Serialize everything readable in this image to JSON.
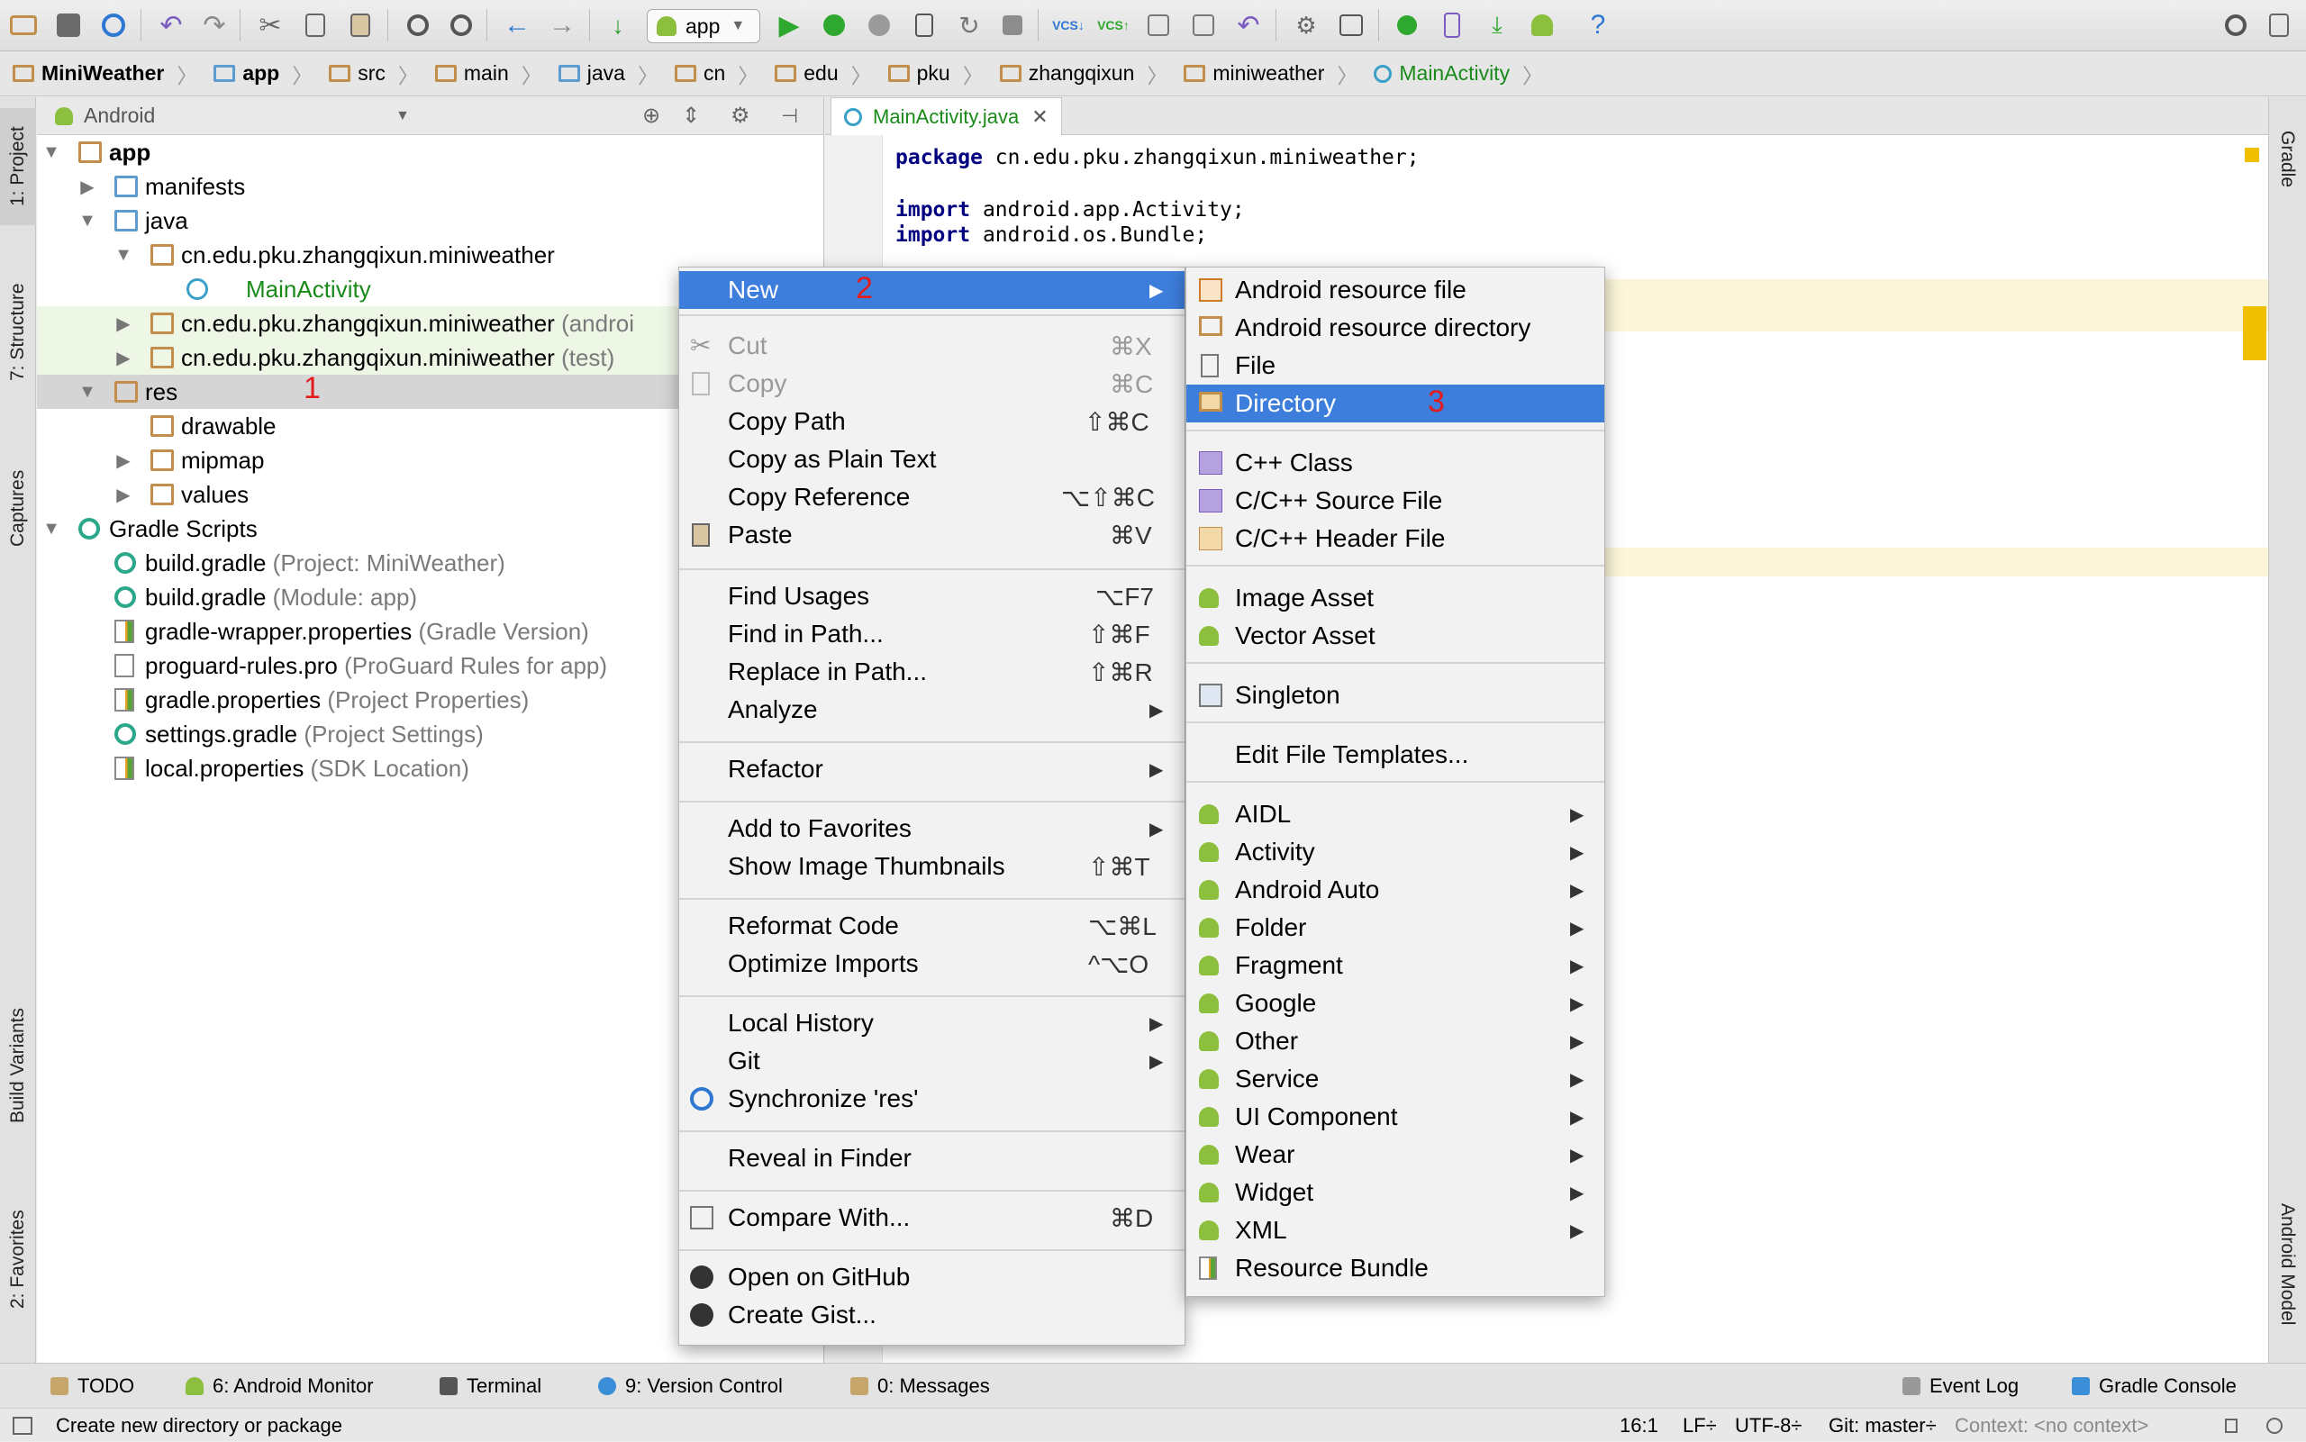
{
  "toolbar": {
    "run_config": "app",
    "buttons": [
      "open-icon",
      "save-icon",
      "sync-icon",
      "undo-icon",
      "redo-icon",
      "cut-icon",
      "copy-icon",
      "paste-icon",
      "find-icon",
      "replace-icon",
      "back-icon",
      "forward-icon",
      "make-icon",
      "run-icon",
      "debug-icon",
      "attach-icon",
      "profile-icon",
      "apply-changes-icon",
      "stop-icon",
      "vcs-update-icon",
      "vcs-commit-icon",
      "vcs-compare-icon",
      "vcs-history-icon",
      "vcs-revert-icon",
      "project-structure-icon",
      "sdk-manager-icon",
      "avd-manager-icon",
      "sync-gradle-icon",
      "android-device-monitor-icon",
      "help-icon"
    ]
  },
  "breadcrumbs": [
    "MiniWeather",
    "app",
    "src",
    "main",
    "java",
    "cn",
    "edu",
    "pku",
    "zhangqixun",
    "miniweather",
    "MainActivity"
  ],
  "project_panel": {
    "view_mode": "Android",
    "tree": [
      {
        "label": "app",
        "extra": ""
      },
      {
        "label": "manifests",
        "extra": ""
      },
      {
        "label": "java",
        "extra": ""
      },
      {
        "label": "cn.edu.pku.zhangqixun.miniweather",
        "extra": ""
      },
      {
        "label": "MainActivity",
        "extra": ""
      },
      {
        "label": "cn.edu.pku.zhangqixun.miniweather",
        "extra": "(androi"
      },
      {
        "label": "cn.edu.pku.zhangqixun.miniweather",
        "extra": "(test)"
      },
      {
        "label": "res",
        "extra": ""
      },
      {
        "label": "drawable",
        "extra": ""
      },
      {
        "label": "mipmap",
        "extra": ""
      },
      {
        "label": "values",
        "extra": ""
      },
      {
        "label": "Gradle Scripts",
        "extra": ""
      },
      {
        "label": "build.gradle",
        "extra": "(Project: MiniWeather)"
      },
      {
        "label": "build.gradle",
        "extra": "(Module: app)"
      },
      {
        "label": "gradle-wrapper.properties",
        "extra": "(Gradle Version)"
      },
      {
        "label": "proguard-rules.pro",
        "extra": "(ProGuard Rules for app)"
      },
      {
        "label": "gradle.properties",
        "extra": "(Project Properties)"
      },
      {
        "label": "settings.gradle",
        "extra": "(Project Settings)"
      },
      {
        "label": "local.properties",
        "extra": "(SDK Location)"
      }
    ]
  },
  "left_tool_tabs": [
    "1: Project",
    "7: Structure",
    "Captures",
    "Build Variants",
    "2: Favorites"
  ],
  "right_tool_tabs": [
    "Gradle",
    "Android Model"
  ],
  "editor": {
    "tab_label": "MainActivity.java",
    "lines": [
      {
        "kw": "package",
        "rest": " cn.edu.pku.zhangqixun.miniweather;"
      },
      {
        "kw": "import",
        "rest": " android.app.Activity;"
      },
      {
        "kw": "import",
        "rest": " android.os.Bundle;"
      }
    ]
  },
  "context_menu": {
    "items": [
      {
        "label": "New",
        "shortcut": "",
        "submenu": true
      },
      {
        "label": "Cut",
        "shortcut": "⌘X",
        "disabled": true
      },
      {
        "label": "Copy",
        "shortcut": "⌘C",
        "disabled": true
      },
      {
        "label": "Copy Path",
        "shortcut": "⇧⌘C"
      },
      {
        "label": "Copy as Plain Text",
        "shortcut": ""
      },
      {
        "label": "Copy Reference",
        "shortcut": "⌥⇧⌘C"
      },
      {
        "label": "Paste",
        "shortcut": "⌘V"
      },
      {
        "label": "Find Usages",
        "shortcut": "⌥F7"
      },
      {
        "label": "Find in Path...",
        "shortcut": "⇧⌘F"
      },
      {
        "label": "Replace in Path...",
        "shortcut": "⇧⌘R"
      },
      {
        "label": "Analyze",
        "shortcut": "",
        "submenu": true
      },
      {
        "label": "Refactor",
        "shortcut": "",
        "submenu": true
      },
      {
        "label": "Add to Favorites",
        "shortcut": "",
        "submenu": true
      },
      {
        "label": "Show Image Thumbnails",
        "shortcut": "⇧⌘T"
      },
      {
        "label": "Reformat Code",
        "shortcut": "⌥⌘L"
      },
      {
        "label": "Optimize Imports",
        "shortcut": "^⌥O"
      },
      {
        "label": "Local History",
        "shortcut": "",
        "submenu": true
      },
      {
        "label": "Git",
        "shortcut": "",
        "submenu": true
      },
      {
        "label": "Synchronize 'res'",
        "shortcut": ""
      },
      {
        "label": "Reveal in Finder",
        "shortcut": ""
      },
      {
        "label": "Compare With...",
        "shortcut": "⌘D"
      },
      {
        "label": "Open on GitHub",
        "shortcut": ""
      },
      {
        "label": "Create Gist...",
        "shortcut": ""
      }
    ]
  },
  "new_submenu": {
    "items": [
      {
        "label": "Android resource file"
      },
      {
        "label": "Android resource directory"
      },
      {
        "label": "File"
      },
      {
        "label": "Directory"
      },
      {
        "label": "C++ Class"
      },
      {
        "label": "C/C++ Source File"
      },
      {
        "label": "C/C++ Header File"
      },
      {
        "label": "Image Asset"
      },
      {
        "label": "Vector Asset"
      },
      {
        "label": "Singleton"
      },
      {
        "label": "Edit File Templates..."
      },
      {
        "label": "AIDL",
        "submenu": true
      },
      {
        "label": "Activity",
        "submenu": true
      },
      {
        "label": "Android Auto",
        "submenu": true
      },
      {
        "label": "Folder",
        "submenu": true
      },
      {
        "label": "Fragment",
        "submenu": true
      },
      {
        "label": "Google",
        "submenu": true
      },
      {
        "label": "Other",
        "submenu": true
      },
      {
        "label": "Service",
        "submenu": true
      },
      {
        "label": "UI Component",
        "submenu": true
      },
      {
        "label": "Wear",
        "submenu": true
      },
      {
        "label": "Widget",
        "submenu": true
      },
      {
        "label": "XML",
        "submenu": true
      },
      {
        "label": "Resource Bundle"
      }
    ]
  },
  "annotations": [
    "1",
    "2",
    "3"
  ],
  "bottom_tool_tabs": [
    {
      "label": "TODO"
    },
    {
      "label": "6: Android Monitor"
    },
    {
      "label": "Terminal"
    },
    {
      "label": "9: Version Control"
    },
    {
      "label": "0: Messages"
    },
    {
      "label": "Event Log"
    },
    {
      "label": "Gradle Console"
    }
  ],
  "status_bar": {
    "message": "Create new directory or package",
    "position": "16:1",
    "line_separator": "LF÷",
    "encoding": "UTF-8÷",
    "vcs": "Git: master÷",
    "context": "Context: <no context>"
  },
  "colors": {
    "selection": "#3d7ddb",
    "annotation": "#e31b1b",
    "android_green": "#8dbf3f",
    "folder_blue": "#5d9bd1",
    "folder_tan": "#c18f4a"
  }
}
